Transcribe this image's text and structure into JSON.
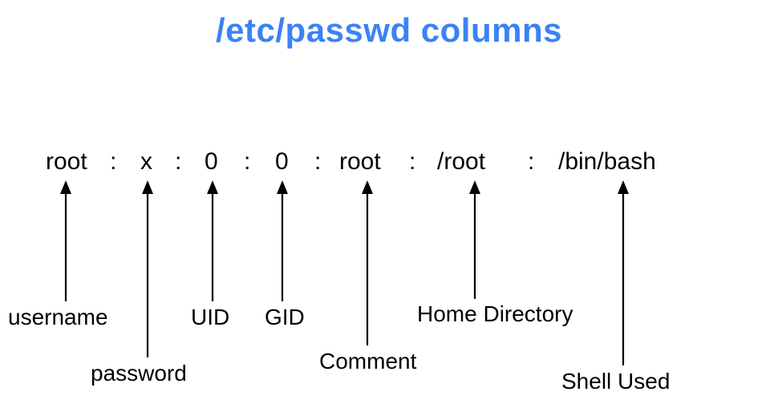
{
  "title": "/etc/passwd columns",
  "separator": ":",
  "fields": {
    "username": {
      "value": "root",
      "label": "username"
    },
    "password": {
      "value": "x",
      "label": "password"
    },
    "uid": {
      "value": "0",
      "label": "UID"
    },
    "gid": {
      "value": "0",
      "label": "GID"
    },
    "comment": {
      "value": "root",
      "label": "Comment"
    },
    "homedir": {
      "value": "/root",
      "label": "Home Directory"
    },
    "shell": {
      "value": "/bin/bash",
      "label": "Shell Used"
    }
  }
}
